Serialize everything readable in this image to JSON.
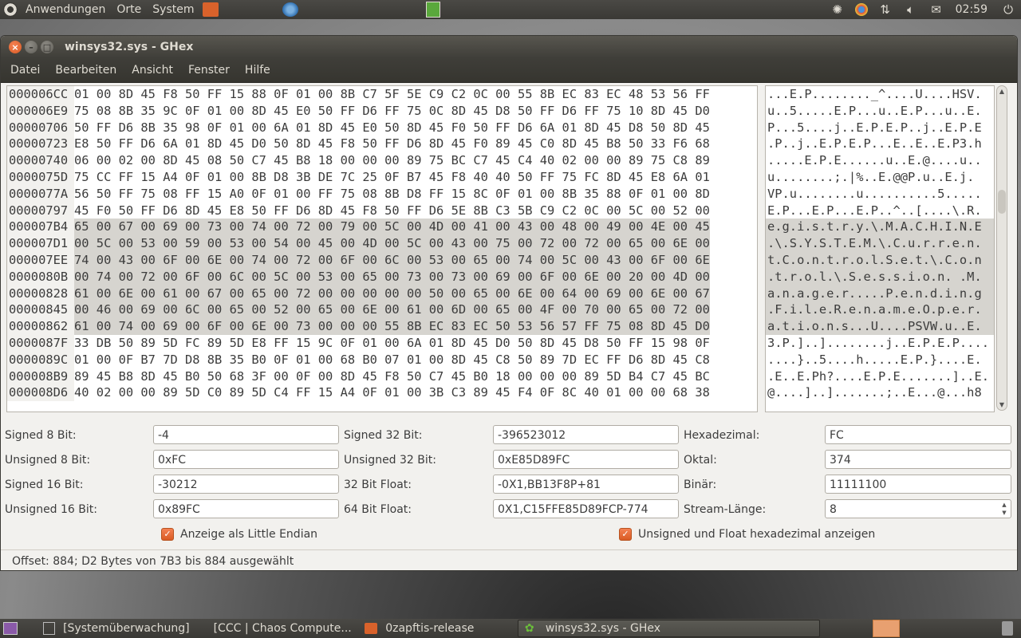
{
  "top_panel": {
    "menus": [
      "Anwendungen",
      "Orte",
      "System"
    ],
    "clock": "02:59"
  },
  "background_window": {
    "title": "0zapftis-release"
  },
  "window": {
    "title": "winsys32.sys - GHex",
    "menu": [
      "Datei",
      "Bearbeiten",
      "Ansicht",
      "Fenster",
      "Hilfe"
    ]
  },
  "hex": {
    "rows": [
      {
        "offset": "000006CC",
        "hex": "01 00 8D 45 F8 50 FF 15 88 0F 01 00 8B C7 5F 5E C9 C2 0C 00 55 8B EC 83 EC 48 53 56 FF",
        "ascii": "...E.P........_^....U....HSV."
      },
      {
        "offset": "000006E9",
        "hex": "75 08 8B 35 9C 0F 01 00 8D 45 E0 50 FF D6 FF 75 0C 8D 45 D8 50 FF D6 FF 75 10 8D 45 D0",
        "ascii": "u..5.....E.P...u..E.P...u..E."
      },
      {
        "offset": "00000706",
        "hex": "50 FF D6 8B 35 98 0F 01 00 6A 01 8D 45 E0 50 8D 45 F0 50 FF D6 6A 01 8D 45 D8 50 8D 45",
        "ascii": "P...5....j..E.P.E.P..j..E.P.E"
      },
      {
        "offset": "00000723",
        "hex": "E8 50 FF D6 6A 01 8D 45 D0 50 8D 45 F8 50 FF D6 8D 45 F0 89 45 C0 8D 45 B8 50 33 F6 68",
        "ascii": ".P..j..E.P.E.P...E..E..E.P3.h"
      },
      {
        "offset": "00000740",
        "hex": "06 00 02 00 8D 45 08 50 C7 45 B8 18 00 00 00 89 75 BC C7 45 C4 40 02 00 00 89 75 C8 89",
        "ascii": ".....E.P.E......u..E.@....u.."
      },
      {
        "offset": "0000075D",
        "hex": "75 CC FF 15 A4 0F 01 00 8B D8 3B DE 7C 25 0F B7 45 F8 40 40 50 FF 75 FC 8D 45 E8 6A 01",
        "ascii": "u........;.|%..E.@@P.u..E.j."
      },
      {
        "offset": "0000077A",
        "hex": "56 50 FF 75 08 FF 15 A0 0F 01 00 FF 75 08 8B D8 FF 15 8C 0F 01 00 8B 35 88 0F 01 00 8D",
        "ascii": "VP.u........u..........5....."
      },
      {
        "offset": "00000797",
        "hex": "45 F0 50 FF D6 8D 45 E8 50 FF D6 8D 45 F8 50 FF D6 5E 8B C3 5B C9 C2 0C 00 5C 00 52 00",
        "ascii": "E.P...E.P...E.P..^..[....\\.R."
      },
      {
        "offset": "000007B4",
        "hex": "65 00 67 00 69 00 73 00 74 00 72 00 79 00 5C 00 4D 00 41 00 43 00 48 00 49 00 4E 00 45",
        "ascii": "e.g.i.s.t.r.y.\\.M.A.C.H.I.N.E"
      },
      {
        "offset": "000007D1",
        "hex": "00 5C 00 53 00 59 00 53 00 54 00 45 00 4D 00 5C 00 43 00 75 00 72 00 72 00 65 00 6E 00",
        "ascii": ".\\.S.Y.S.T.E.M.\\.C.u.r.r.e.n."
      },
      {
        "offset": "000007EE",
        "hex": "74 00 43 00 6F 00 6E 00 74 00 72 00 6F 00 6C 00 53 00 65 00 74 00 5C 00 43 00 6F 00 6E",
        "ascii": "t.C.o.n.t.r.o.l.S.e.t.\\.C.o.n"
      },
      {
        "offset": "0000080B",
        "hex": "00 74 00 72 00 6F 00 6C 00 5C 00 53 00 65 00 73 00 73 00 69 00 6F 00 6E 00 20 00 4D 00",
        "ascii": ".t.r.o.l.\\.S.e.s.s.i.o.n. .M."
      },
      {
        "offset": "00000828",
        "hex": "61 00 6E 00 61 00 67 00 65 00 72 00 00 00 00 00 50 00 65 00 6E 00 64 00 69 00 6E 00 67",
        "ascii": "a.n.a.g.e.r.....P.e.n.d.i.n.g"
      },
      {
        "offset": "00000845",
        "hex": "00 46 00 69 00 6C 00 65 00 52 00 65 00 6E 00 61 00 6D 00 65 00 4F 00 70 00 65 00 72 00",
        "ascii": ".F.i.l.e.R.e.n.a.m.e.O.p.e.r."
      },
      {
        "offset": "00000862",
        "hex": "61 00 74 00 69 00 6F 00 6E 00 73 00 00 00 55 8B EC 83 EC 50 53 56 57 FF 75 08 8D 45 D0",
        "ascii": "a.t.i.o.n.s...U....PSVW.u..E."
      },
      {
        "offset": "0000087F",
        "hex": "33 DB 50 89 5D FC 89 5D E8 FF 15 9C 0F 01 00 6A 01 8D 45 D0 50 8D 45 D8 50 FF 15 98 0F",
        "ascii": "3.P.]..]........j..E.P.E.P...."
      },
      {
        "offset": "0000089C",
        "hex": "01 00 0F B7 7D D8 8B 35 B0 0F 01 00 68 B0 07 01 00 8D 45 C8 50 89 7D EC FF D6 8D 45 C8",
        "ascii": "....}..5....h.....E.P.}....E."
      },
      {
        "offset": "000008B9",
        "hex": "89 45 B8 8D 45 B0 50 68 3F 00 0F 00 8D 45 F8 50 C7 45 B0 18 00 00 00 89 5D B4 C7 45 BC",
        "ascii": ".E..E.Ph?....E.P.E.......]..E."
      },
      {
        "offset": "000008D6",
        "hex": "40 02 00 00 89 5D C0 89 5D C4 FF 15 A4 0F 01 00 3B C3 89 45 F4 0F 8C 40 01 00 00 68 38",
        "ascii": "@....]..].......;..E...@...h8"
      }
    ]
  },
  "converter": {
    "signed8_label": "Signed 8 Bit:",
    "signed8": "-4",
    "unsigned8_label": "Unsigned 8 Bit:",
    "unsigned8": "0xFC",
    "signed16_label": "Signed 16 Bit:",
    "signed16": "-30212",
    "unsigned16_label": "Unsigned 16 Bit:",
    "unsigned16": "0x89FC",
    "signed32_label": "Signed 32 Bit:",
    "signed32": "-396523012",
    "unsigned32_label": "Unsigned 32 Bit:",
    "unsigned32": "0xE85D89FC",
    "float32_label": "32 Bit Float:",
    "float32": "-0X1,BB13F8P+81",
    "float64_label": "64 Bit Float:",
    "float64": "0X1,C15FFE85D89FCP-774",
    "hex_label": "Hexadezimal:",
    "hex": "FC",
    "oct_label": "Oktal:",
    "oct": "374",
    "bin_label": "Binär:",
    "bin": "11111100",
    "stream_label": "Stream-Länge:",
    "stream": "8",
    "little_endian_label": "Anzeige als Little Endian",
    "unsigned_hex_label": "Unsigned und Float hexadezimal anzeigen"
  },
  "status": "Offset: 884; D2 Bytes von 7B3 bis 884 ausgewählt",
  "taskbar": [
    {
      "label": "[Systemüberwachung]"
    },
    {
      "label": "[CCC | Chaos Compute..."
    },
    {
      "label": "0zapftis-release"
    },
    {
      "label": "winsys32.sys - GHex"
    }
  ],
  "colors": {
    "accent": "#e05a24",
    "panel": "#3c3b37",
    "selection": "#d6d4cf"
  }
}
